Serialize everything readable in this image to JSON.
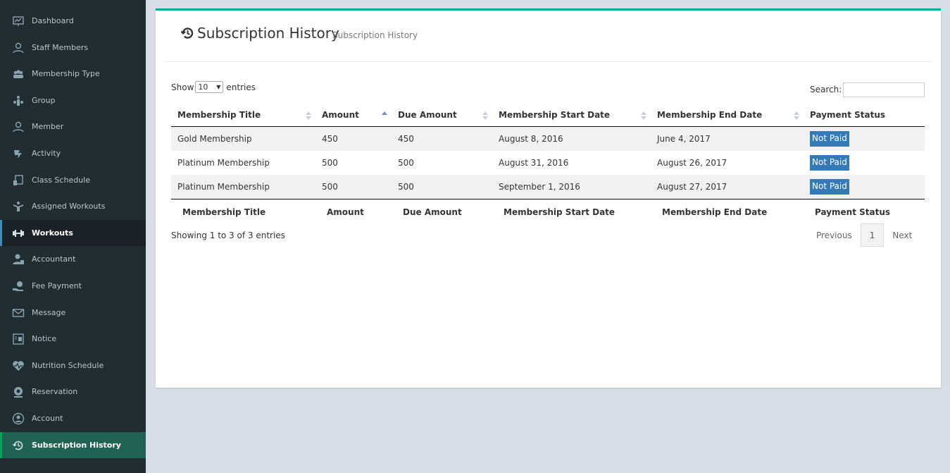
{
  "sidebar": {
    "items": [
      {
        "label": "Dashboard",
        "icon": "dashboard-icon"
      },
      {
        "label": "Staff Members",
        "icon": "staff-icon"
      },
      {
        "label": "Membership Type",
        "icon": "membership-icon"
      },
      {
        "label": "Group",
        "icon": "group-icon"
      },
      {
        "label": "Member",
        "icon": "member-icon"
      },
      {
        "label": "Activity",
        "icon": "activity-icon"
      },
      {
        "label": "Class Schedule",
        "icon": "class-schedule-icon"
      },
      {
        "label": "Assigned Workouts",
        "icon": "assigned-workouts-icon"
      },
      {
        "label": "Workouts",
        "icon": "workouts-icon"
      },
      {
        "label": "Accountant",
        "icon": "accountant-icon"
      },
      {
        "label": "Fee Payment",
        "icon": "fee-payment-icon"
      },
      {
        "label": "Message",
        "icon": "message-icon"
      },
      {
        "label": "Notice",
        "icon": "notice-icon"
      },
      {
        "label": "Nutrition Schedule",
        "icon": "nutrition-icon"
      },
      {
        "label": "Reservation",
        "icon": "reservation-icon"
      },
      {
        "label": "Account",
        "icon": "account-icon"
      },
      {
        "label": "Subscription History",
        "icon": "subscription-history-icon"
      }
    ]
  },
  "header": {
    "title": "Subscription History",
    "subtitle": "Subscription History"
  },
  "controls": {
    "show_label": "Show",
    "entries_value": "10",
    "entries_label": "entries",
    "search_label": "Search:"
  },
  "table": {
    "columns": [
      "Membership Title",
      "Amount",
      "Due Amount",
      "Membership Start Date",
      "Membership End Date",
      "Payment Status"
    ],
    "rows": [
      [
        "Gold Membership",
        "450",
        "450",
        "August 8, 2016",
        "June 4, 2017",
        "Not Paid"
      ],
      [
        "Platinum Membership",
        "500",
        "500",
        "August 31, 2016",
        "August 26, 2017",
        "Not Paid"
      ],
      [
        "Platinum Membership",
        "500",
        "500",
        "September 1, 2016",
        "August 27, 2017",
        "Not Paid"
      ]
    ]
  },
  "footer": {
    "info": "Showing 1 to 3 of 3 entries",
    "previous": "Previous",
    "page": "1",
    "next": "Next"
  },
  "colors": {
    "sidebar_bg": "#222d32",
    "accent_teal": "#00a99d",
    "badge_blue": "#337ab7"
  }
}
